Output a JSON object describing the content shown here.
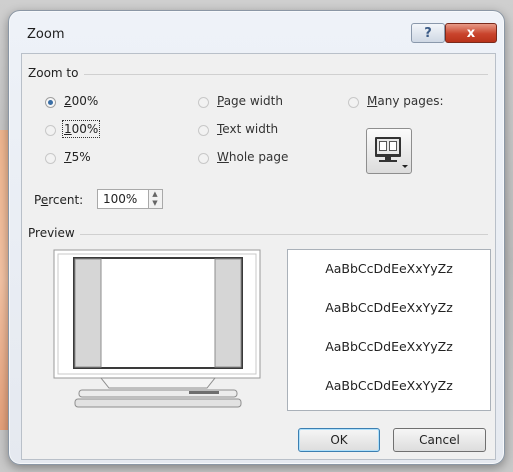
{
  "window": {
    "title": "Zoom",
    "help_glyph": "?",
    "close_glyph": "x"
  },
  "zoom_to": {
    "label": "Zoom to",
    "options": [
      {
        "label": "200%",
        "mnemonic": "2",
        "rest": "00%",
        "checked": true
      },
      {
        "label": "100%",
        "mnemonic": "1",
        "rest": "00%",
        "checked": false
      },
      {
        "label": "75%",
        "mnemonic": "7",
        "rest": "5%",
        "checked": false
      },
      {
        "label": "Page width",
        "mnemonic": "P",
        "rest": "age width",
        "checked": false
      },
      {
        "label": "Text width",
        "mnemonic": "T",
        "rest": "ext width",
        "checked": false
      },
      {
        "label": "Whole page",
        "mnemonic": "W",
        "rest": "hole page",
        "checked": false
      },
      {
        "label": "Many pages:",
        "mnemonic": "M",
        "rest": "any pages:",
        "checked": false
      }
    ]
  },
  "percent": {
    "label_pre": "P",
    "label_mnemonic": "e",
    "label_post": "rcent:",
    "value": "100%"
  },
  "preview": {
    "label": "Preview",
    "sample_text": [
      "AaBbCcDdEeXxYyZz",
      "AaBbCcDdEeXxYyZz",
      "AaBbCcDdEeXxYyZz",
      "AaBbCcDdEeXxYyZz"
    ]
  },
  "buttons": {
    "ok": "OK",
    "cancel": "Cancel"
  },
  "icons": {
    "help": "question-mark-icon",
    "close": "close-icon",
    "many_pages": "monitor-pages-icon",
    "spinner_up": "chevron-up-icon",
    "spinner_down": "chevron-down-icon"
  },
  "colors": {
    "close_button": "#c9442c",
    "radio_selected": "#3a6ea5",
    "orange_edge": "#f0b68e"
  }
}
